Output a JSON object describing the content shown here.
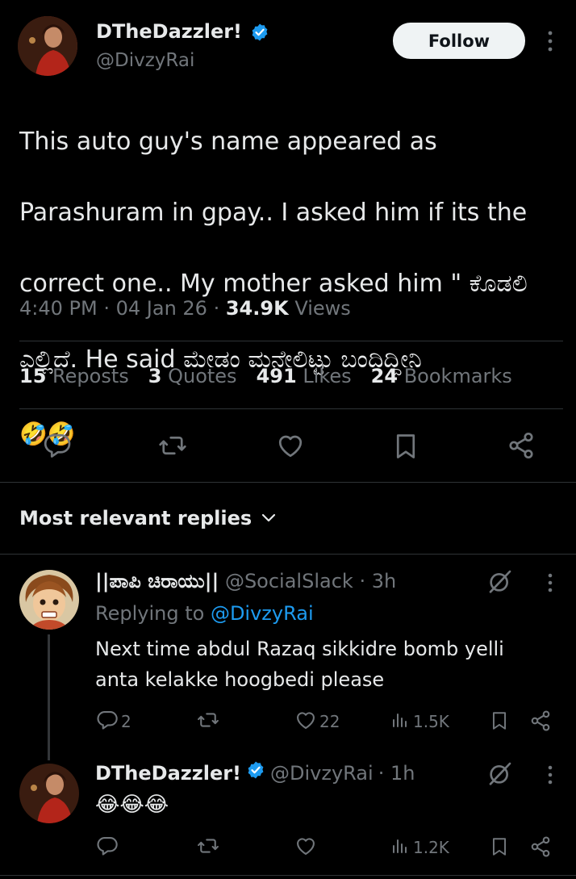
{
  "tweet": {
    "author_name": "DTheDazzler!",
    "author_handle": "@DivzyRai",
    "follow_label": "Follow",
    "text_line1": "This auto guy's name appeared as",
    "text_line2": "Parashuram in gpay.. I asked him if its the",
    "text_line3": "correct one.. My mother asked him \" ಕೊಡಲಿ",
    "text_line4": "ಎಲ್ಲಿದೆ.  He said ಮೇಡಂ ಮನೇಲಿಟ್ಟು ಬಂದಿದ್ದೀನಿ",
    "emoji_line": "🤣🤣",
    "time": "4:40 PM",
    "date": "04 Jan 26",
    "views_count": "34.9K",
    "views_label": "Views",
    "reposts_count": "15",
    "reposts_label": "Reposts",
    "quotes_count": "3",
    "quotes_label": "Quotes",
    "likes_count": "491",
    "likes_label": "Likes",
    "bookmarks_count": "24",
    "bookmarks_label": "Bookmarks"
  },
  "replies_header": "Most relevant replies",
  "replies": [
    {
      "name": "||ಪಾಪಿ ಚಿರಾಯು||",
      "handle": "@SocialSlack",
      "time": "· 3h",
      "replying_prefix": "Replying to",
      "replying_to": "@DivzyRai",
      "text_line1": "Next time abdul Razaq sikkidre bomb yelli",
      "text_line2": "anta kelakke hoogbedi please",
      "reply_count": "2",
      "like_count": "22",
      "views": "1.5K"
    },
    {
      "name": "DTheDazzler!",
      "handle": "@DivzyRai",
      "time": "· 1h",
      "text_line1": "😂😂😂",
      "views": "1.2K"
    }
  ],
  "colors": {
    "background": "#000000",
    "text": "#e7e9ea",
    "muted": "#71767b",
    "accent": "#1d9bf0",
    "divider": "#2f3336"
  }
}
